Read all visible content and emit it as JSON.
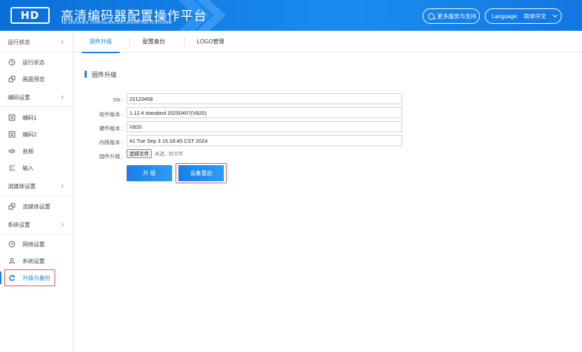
{
  "header": {
    "logo_text": "HD",
    "title": "高清编码器配置操作平台",
    "subtitle": "HD ENCODER CONFIGURATION OPERATING PLATFORM",
    "more_services": "更多服务与支持",
    "language_label": "Language:",
    "language_value": "简体中文"
  },
  "sidebar": {
    "groups": [
      {
        "label": "运行状态",
        "items": [
          {
            "label": "运行状态",
            "icon": "clock-icon"
          },
          {
            "label": "画面预览",
            "icon": "preview-icon"
          }
        ]
      },
      {
        "label": "编码设置",
        "items": [
          {
            "label": "编码1",
            "icon": "encode-icon"
          },
          {
            "label": "编码2",
            "icon": "encode-icon"
          },
          {
            "label": "音频",
            "icon": "audio-icon"
          },
          {
            "label": "输入",
            "icon": "input-icon"
          }
        ]
      },
      {
        "label": "流媒体设置",
        "items": [
          {
            "label": "流媒体设置",
            "icon": "stream-icon"
          }
        ]
      },
      {
        "label": "系统设置",
        "items": [
          {
            "label": "网络设置",
            "icon": "network-icon"
          },
          {
            "label": "系统设置",
            "icon": "user-icon"
          },
          {
            "label": "升级与备份",
            "icon": "refresh-icon",
            "active": true
          }
        ]
      }
    ]
  },
  "tabs": [
    {
      "label": "固件升级",
      "active": true
    },
    {
      "label": "配置备份",
      "active": false
    },
    {
      "label": "LOGO管理",
      "active": false
    }
  ],
  "content": {
    "section_title": "固件升级",
    "fields": [
      {
        "label": "SN :",
        "value": "22123458"
      },
      {
        "label": "软件版本 :",
        "value": "1.12.4 standard 20250407(V820)"
      },
      {
        "label": "硬件版本 :",
        "value": "V820"
      },
      {
        "label": "内核版本 :",
        "value": "#1 Tue Sep 3 15:18:45 CST 2024"
      }
    ],
    "firmware_label": "固件升级 :",
    "file_button": "选择文件",
    "file_status": "未选...何文件",
    "upgrade_button": "升 级",
    "reboot_button": "设备重启"
  },
  "colors": {
    "accent": "#1a7fe8",
    "highlight": "#e0505a"
  }
}
